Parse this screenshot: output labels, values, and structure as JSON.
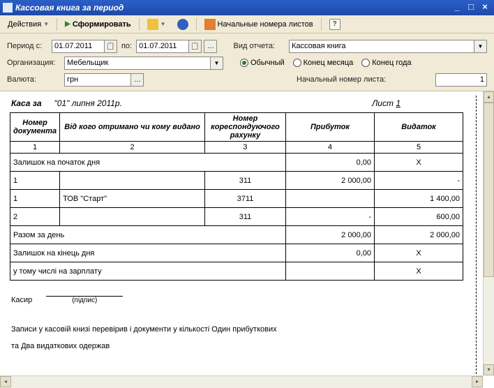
{
  "window": {
    "title": "Кассовая книга за период"
  },
  "toolbar": {
    "actions": "Действия",
    "form": "Сформировать",
    "sheets": "Начальные номера листов",
    "help": "?"
  },
  "params": {
    "period_label": "Период с:",
    "date_from": "01.07.2011",
    "po_label": "по:",
    "date_to": "01.07.2011",
    "vidotch_label": "Вид отчета:",
    "vidotch_value": "Кассовая книга",
    "org_label": "Организация:",
    "org_value": "Мебельщик",
    "radio_usual": "Обычный",
    "radio_month": "Конец месяца",
    "radio_year": "Конец года",
    "valuta_label": "Валюта:",
    "valuta_value": "грн",
    "nachnum_label": "Начальный номер листа:",
    "nachnum_value": "1"
  },
  "report": {
    "kasa_za": "Каса за",
    "header_date": "\"01\" липня 2011р.",
    "sheet_label": "Лист",
    "sheet_num": "1",
    "col_doc": "Номер документа",
    "col_who": "Від кого отримано чи кому видано",
    "col_acc": "Номер кореспондуючого рахунку",
    "col_inc": "Прибуток",
    "col_exp": "Видаток",
    "numrow": [
      "1",
      "2",
      "3",
      "4",
      "5"
    ],
    "rows": [
      {
        "merge": true,
        "label": "Залишок на початок дня",
        "inc": "0,00",
        "exp": "X"
      },
      {
        "doc": "1",
        "who": "",
        "acc": "311",
        "inc": "2 000,00",
        "exp": "-"
      },
      {
        "doc": "1",
        "who": "ТОВ \"Старт\"",
        "acc": "3711",
        "inc": "",
        "exp": "1 400,00"
      },
      {
        "doc": "2",
        "who": "",
        "acc": "311",
        "inc": "-",
        "exp": "600,00"
      },
      {
        "merge": true,
        "label": "Разом за день",
        "inc": "2 000,00",
        "exp": "2 000,00"
      },
      {
        "merge": true,
        "label": "Залишок на кінець дня",
        "inc": "0,00",
        "exp": "X"
      },
      {
        "merge": true,
        "label": "у тому числі на зарплату",
        "inc": "",
        "exp": "X"
      }
    ],
    "cashier": "Касир",
    "signature": "(підпис)",
    "records_line1": "Записи у касовій книзі перевірив і документи у кількості Один прибуткових",
    "records_line2": "та Два видаткових одержав"
  }
}
